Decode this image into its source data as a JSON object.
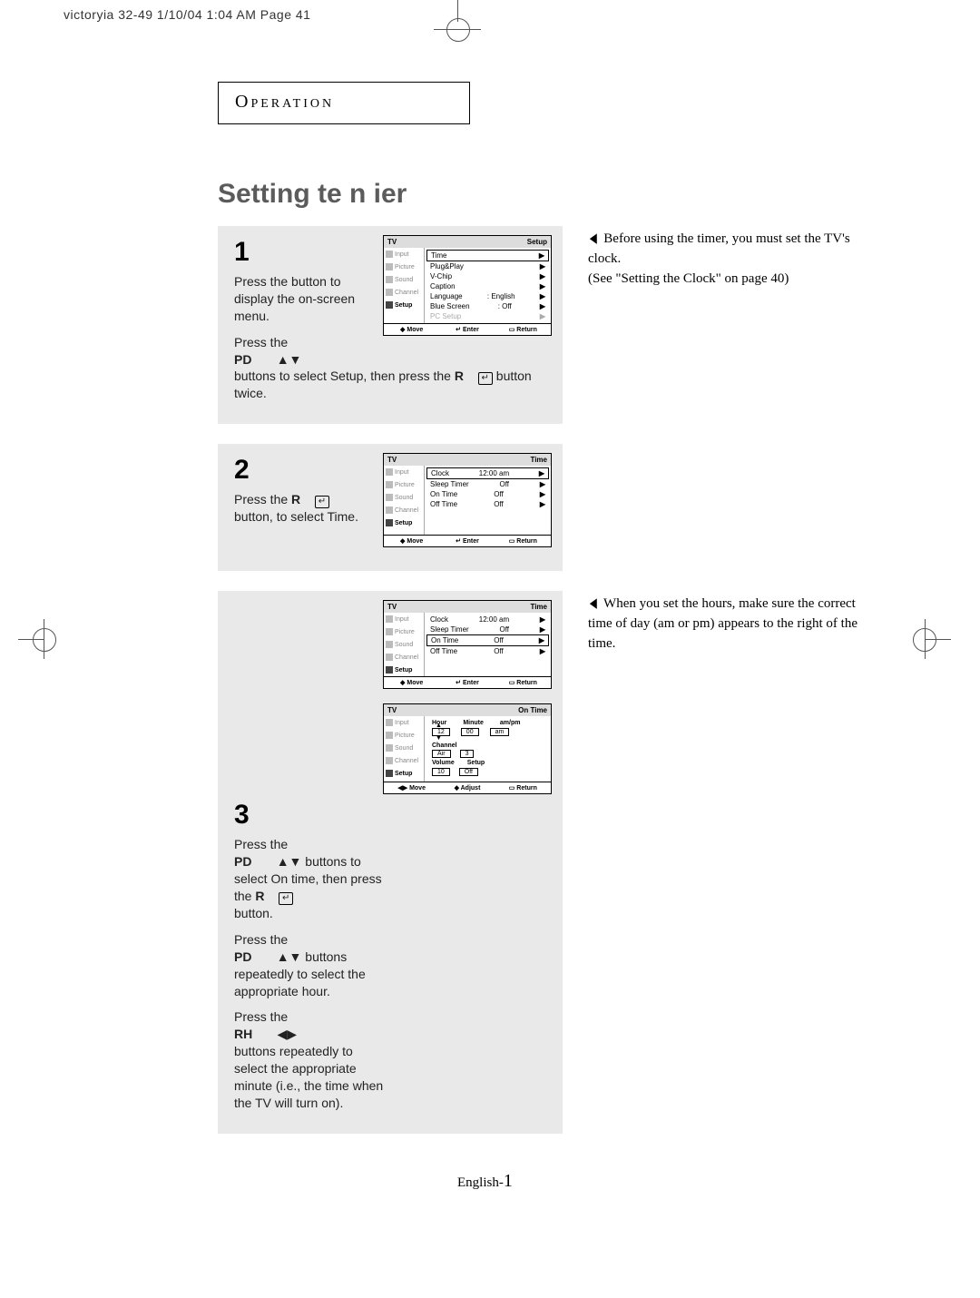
{
  "slug": "victoryia 32-49  1/10/04 1:04 AM  Page 41",
  "section_label": "Operation",
  "page_title": "Setting te  n  ier",
  "footer": {
    "lang": "English-",
    "page_num": "1"
  },
  "step1": {
    "num": "1",
    "p1a": "Press the ",
    "p1b": " button to display the on-screen menu.",
    "p2a": "Press the",
    "pd_label": "PD",
    "updown": "▲▼",
    "p2b": "buttons to select Setup, then press the",
    "r_label": "R",
    "enter_symbol": "↵",
    "p2c": " button twice.",
    "osd": {
      "title_l": "TV",
      "title_r": "Setup",
      "side": [
        "Input",
        "Picture",
        "Sound",
        "Channel",
        "Setup"
      ],
      "rows": [
        {
          "l": "Time",
          "r": "",
          "sel": true,
          "dis": false
        },
        {
          "l": "Plug&Play",
          "r": "",
          "dis": false
        },
        {
          "l": "V-Chip",
          "r": "",
          "dis": false
        },
        {
          "l": "Caption",
          "r": "",
          "dis": false
        },
        {
          "l": "Language",
          "r": ":   English",
          "dis": false
        },
        {
          "l": "Blue Screen",
          "r": ":   Off",
          "dis": false
        },
        {
          "l": "PC Setup",
          "r": "",
          "dis": true
        }
      ],
      "foot": [
        "◆ Move",
        "↵ Enter",
        "▭ Return"
      ]
    }
  },
  "step2": {
    "num": "2",
    "p1a": "Press the ",
    "r_label": "R",
    "enter_symbol": "↵",
    "p1b": "button, to select Time.",
    "osd": {
      "title_l": "TV",
      "title_r": "Time",
      "side": [
        "Input",
        "Picture",
        "Sound",
        "Channel",
        "Setup"
      ],
      "rows": [
        {
          "l": "Clock",
          "r": "12:00 am",
          "sel": true
        },
        {
          "l": "Sleep Timer",
          "r": "Off"
        },
        {
          "l": "On Time",
          "r": "Off"
        },
        {
          "l": "Off Time",
          "r": "Off"
        }
      ],
      "foot": [
        "◆ Move",
        "↵ Enter",
        "▭ Return"
      ]
    }
  },
  "step3": {
    "num": "3",
    "p1a": "Press the",
    "pd_label": "PD",
    "updown": "▲▼",
    "p1b": " buttons to select On time, then press the ",
    "r_label": "R",
    "enter_symbol": "↵",
    "p1c": "button.",
    "p2a": "Press the",
    "p2b": " buttons repeatedly to select the appropriate hour.",
    "p3a": "Press the",
    "rh_label": "RH",
    "leftright": "◀▶",
    "p3b": "buttons repeatedly to select the appropriate minute (i.e., the time when the TV will turn on).",
    "osd_a": {
      "title_l": "TV",
      "title_r": "Time",
      "side": [
        "Input",
        "Picture",
        "Sound",
        "Channel",
        "Setup"
      ],
      "rows": [
        {
          "l": "Clock",
          "r": "12:00 am"
        },
        {
          "l": "Sleep Timer",
          "r": "Off"
        },
        {
          "l": "On Time",
          "r": "Off",
          "sel": true
        },
        {
          "l": "Off Time",
          "r": "Off"
        }
      ],
      "foot": [
        "◆ Move",
        "↵ Enter",
        "▭ Return"
      ]
    },
    "osd_b": {
      "title_l": "TV",
      "title_r": "On Time",
      "side": [
        "Input",
        "Picture",
        "Sound",
        "Channel",
        "Setup"
      ],
      "labels": {
        "hour": "Hour",
        "minute": "Minute",
        "ampm": "am/pm"
      },
      "vals": {
        "hour": "12",
        "minute": "00",
        "ampm": "am"
      },
      "channel_label": "Channel",
      "channel_vals": [
        "Air",
        "3"
      ],
      "vol_setup_labels": [
        "Volume",
        "Setup"
      ],
      "vol_setup_vals": [
        "10",
        "Off"
      ],
      "foot": [
        "◀▶ Move",
        "◆ Adjust",
        "▭ Return"
      ]
    }
  },
  "note1": {
    "caret": "◀",
    "t1": "Before using the timer, you must set the TV's clock.",
    "t2": "(See \"Setting the Clock\" on page 40)"
  },
  "note2": {
    "caret": "◀",
    "t1": "When you set the hours, make sure the correct time of day (am or pm) appears to the right of the time."
  }
}
